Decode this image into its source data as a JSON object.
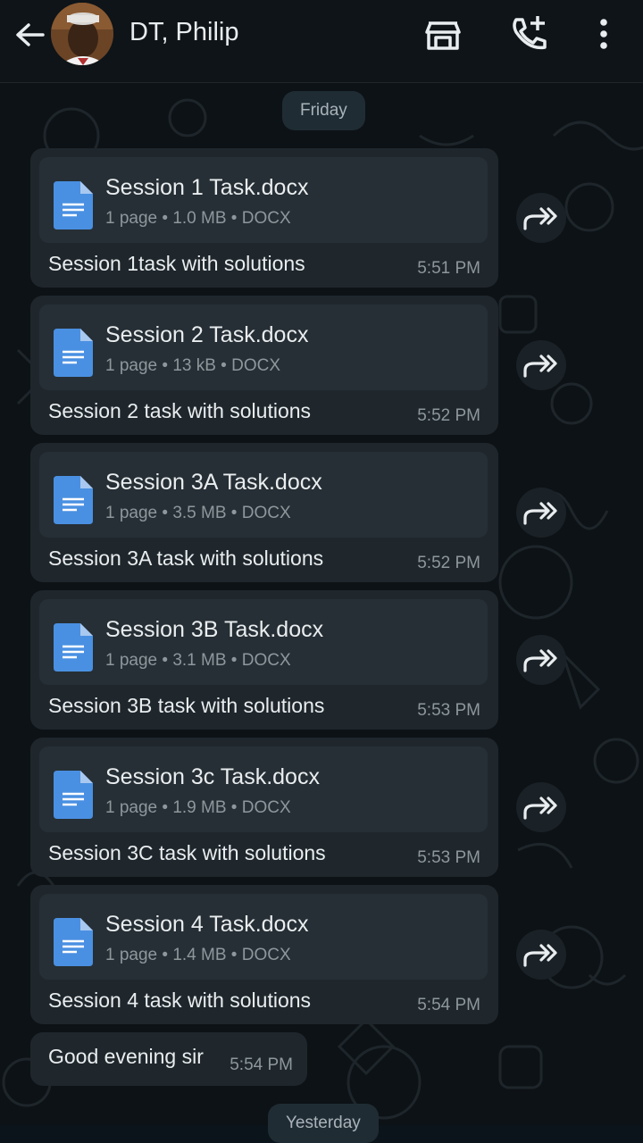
{
  "header": {
    "contact_name": "DT, Philip",
    "icons": [
      "back-arrow-icon",
      "store-icon",
      "add-call-icon",
      "more-vert-icon"
    ]
  },
  "date_dividers": {
    "first": "Friday",
    "second": "Yesterday"
  },
  "messages": [
    {
      "file_name": "Session 1 Task.docx",
      "meta": "1 page • 1.0 MB • DOCX",
      "caption": "Session 1task  with solutions",
      "time": "5:51 PM"
    },
    {
      "file_name": "Session 2 Task.docx",
      "meta": "1 page • 13 kB • DOCX",
      "caption": "Session 2 task with solutions",
      "time": "5:52 PM"
    },
    {
      "file_name": "Session 3A Task.docx",
      "meta": "1 page • 3.5 MB • DOCX",
      "caption": "Session 3A task with solutions",
      "time": "5:52 PM"
    },
    {
      "file_name": "Session 3B Task.docx",
      "meta": "1 page • 3.1 MB • DOCX",
      "caption": "Session 3B task with solutions",
      "time": "5:53 PM"
    },
    {
      "file_name": "Session 3c Task.docx",
      "meta": "1 page • 1.9 MB • DOCX",
      "caption": "Session 3C task with solutions",
      "time": "5:53 PM"
    },
    {
      "file_name": "Session 4 Task.docx",
      "meta": "1 page • 1.4 MB • DOCX",
      "caption": "Session 4 task with solutions",
      "time": "5:54 PM"
    }
  ],
  "text_message": {
    "text": "Good evening sir",
    "time": "5:54 PM"
  },
  "colors": {
    "background": "#0b141a",
    "bubble": "#1f272d",
    "doc_card": "#262f35",
    "doc_icon": "#4a90e2",
    "secondary_text": "#8d979c"
  }
}
